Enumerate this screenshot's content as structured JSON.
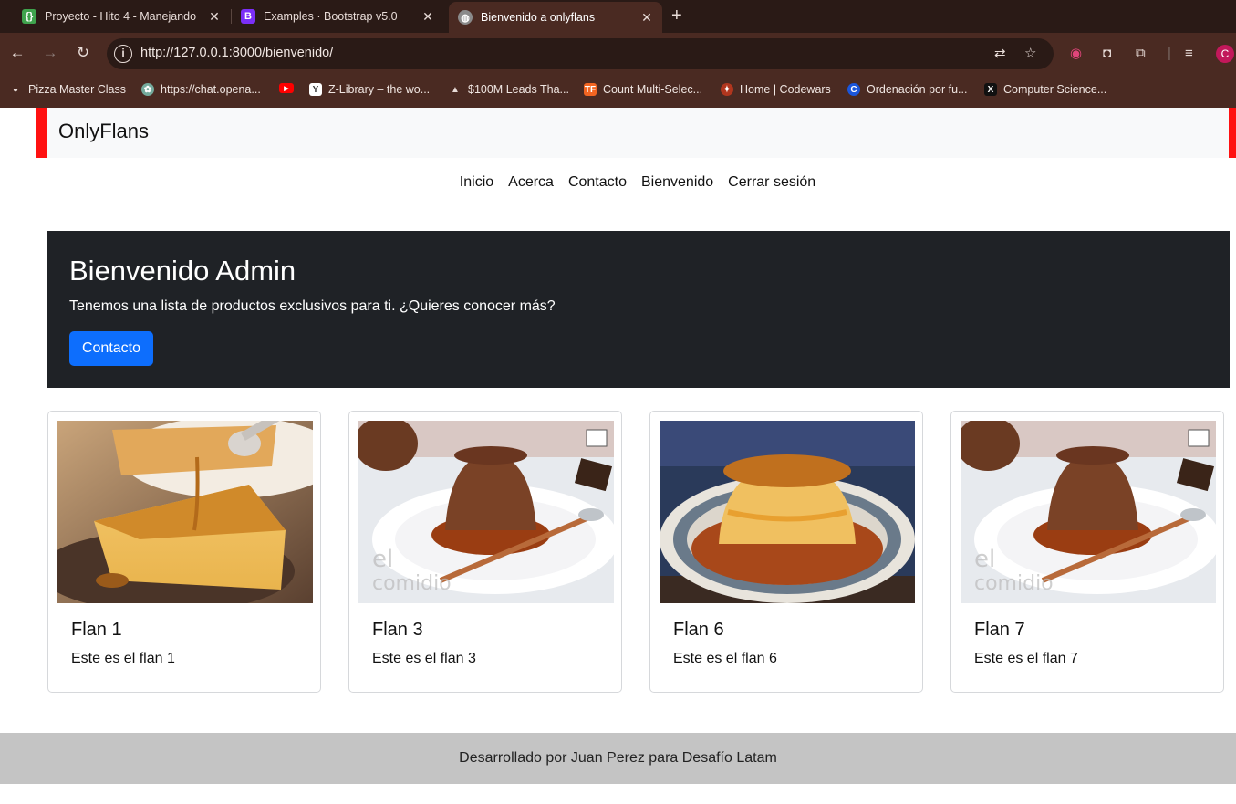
{
  "browser": {
    "tabs": [
      {
        "title": "Proyecto - Hito 4 - Manejando",
        "icon": "code-brackets-icon",
        "color": "#3fa34d"
      },
      {
        "title": "Examples · Bootstrap v5.0",
        "icon": "bootstrap-icon",
        "color": "#7b2ff7"
      },
      {
        "title": "Bienvenido a onlyflans",
        "icon": "globe-icon",
        "color": "#8a8a8a"
      }
    ],
    "url": "http://127.0.0.1:8000/bienvenido/",
    "profile_initial": "C",
    "bookmarks": [
      {
        "label": "Pizza Master Class",
        "icon": "pizza-icon"
      },
      {
        "label": "https://chat.opena...",
        "icon": "openai-icon"
      },
      {
        "label": "",
        "icon": "youtube-icon"
      },
      {
        "label": "Z-Library – the wo...",
        "icon": "zlibrary-icon"
      },
      {
        "label": "$100M Leads Tha...",
        "icon": "triangle-icon"
      },
      {
        "label": "Count Multi-Selec...",
        "icon": "tf-icon"
      },
      {
        "label": "Home | Codewars",
        "icon": "codewars-icon"
      },
      {
        "label": "Ordenación por fu...",
        "icon": "c-icon"
      },
      {
        "label": "Computer Science...",
        "icon": "x-icon"
      }
    ]
  },
  "site": {
    "brand": "OnlyFlans",
    "nav": [
      "Inicio",
      "Acerca",
      "Contacto",
      "Bienvenido",
      "Cerrar sesión"
    ],
    "accent_color": "#ff1111"
  },
  "hero": {
    "title": "Bienvenido Admin",
    "subtitle": "Tenemos una lista de productos exclusivos para ti. ¿Quieres conocer más?",
    "button": "Contacto"
  },
  "cards": [
    {
      "title": "Flan 1",
      "text": "Este es el flan 1",
      "image": "caramel-flan-slice"
    },
    {
      "title": "Flan 3",
      "text": "Este es el flan 3",
      "image": "chocolate-flan"
    },
    {
      "title": "Flan 6",
      "text": "Este es el flan 6",
      "image": "caramel-flan-plate"
    },
    {
      "title": "Flan 7",
      "text": "Este es el flan 7",
      "image": "chocolate-flan"
    }
  ],
  "footer": "Desarrollado por Juan Perez para Desafío Latam"
}
